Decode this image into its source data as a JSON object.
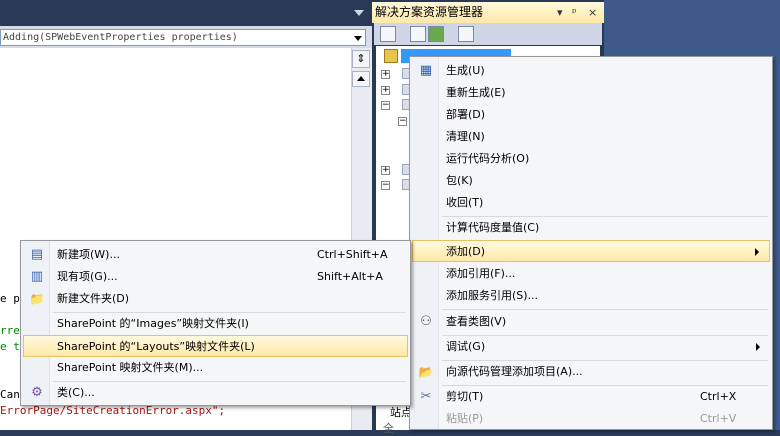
{
  "editor": {
    "member_combo": "Adding(SPWebEventProperties properties)",
    "code_lines": [
      {
        "text": "e p",
        "color": "#000000"
      },
      {
        "text": "rren",
        "color": "#008000"
      },
      {
        "text": "e th",
        "color": "#008000"
      },
      {
        "text": "Canc",
        "color": "#000000"
      },
      {
        "text": "ErrorPage/SiteCreationError.aspx\";",
        "color": "#a31515"
      }
    ]
  },
  "solution_explorer": {
    "title": "解决方案资源管理器",
    "controls": [
      "▾",
      "ᵖ",
      "×"
    ],
    "tree_labels": [
      "站点",
      "全"
    ]
  },
  "context_menu": {
    "items": [
      {
        "label": "生成(U)",
        "icon": "build-icon",
        "glyph": "▦"
      },
      {
        "label": "重新生成(E)"
      },
      {
        "label": "部署(D)"
      },
      {
        "label": "清理(N)"
      },
      {
        "label": "运行代码分析(O)"
      },
      {
        "label": "包(K)"
      },
      {
        "label": "收回(T)"
      },
      {
        "label": "计算代码度量值(C)"
      },
      {
        "label": "添加(D)",
        "submenu": true,
        "highlighted": true
      },
      {
        "label": "添加引用(F)..."
      },
      {
        "label": "添加服务引用(S)..."
      },
      {
        "label": "查看类图(V)",
        "icon": "class-diagram-icon",
        "glyph": "⚇"
      },
      {
        "label": "调试(G)",
        "submenu": true
      },
      {
        "label": "向源代码管理添加项目(A)...",
        "icon": "source-control-add-icon",
        "glyph": "📂"
      },
      {
        "label": "剪切(T)",
        "shortcut": "Ctrl+X",
        "icon": "scissors-icon",
        "glyph": "✂"
      },
      {
        "label": "粘贴(P)",
        "shortcut": "Ctrl+V",
        "disabled": true
      }
    ]
  },
  "add_submenu": {
    "items": [
      {
        "label": "新建项(W)...",
        "shortcut": "Ctrl+Shift+A",
        "icon": "new-item-icon",
        "glyph": "▤"
      },
      {
        "label": "现有项(G)...",
        "shortcut": "Shift+Alt+A",
        "icon": "existing-item-icon",
        "glyph": "▥"
      },
      {
        "label": "新建文件夹(D)",
        "icon": "folder-icon",
        "glyph": "📁"
      },
      {
        "label": "SharePoint 的“Images”映射文件夹(I)"
      },
      {
        "label": "SharePoint 的“Layouts”映射文件夹(L)",
        "highlighted": true
      },
      {
        "label": "SharePoint 映射文件夹(M)..."
      },
      {
        "label": "类(C)...",
        "icon": "class-icon",
        "glyph": "⚙"
      }
    ]
  }
}
